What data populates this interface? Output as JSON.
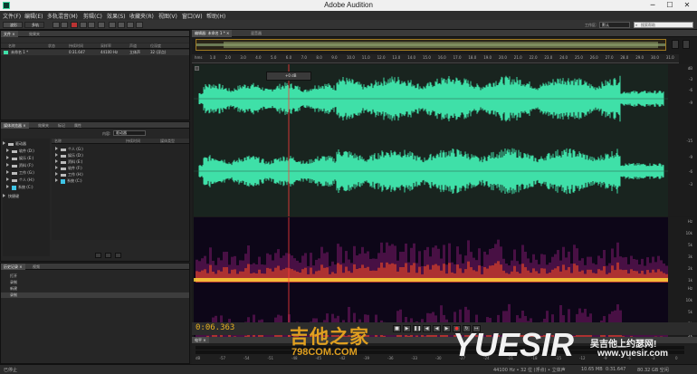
{
  "window": {
    "title": "Adobe Audition",
    "minimize": "─",
    "maximize": "☐",
    "close": "✕"
  },
  "menu": [
    "文件(F)",
    "编辑(E)",
    "多轨混音(M)",
    "剪辑(C)",
    "效果(S)",
    "收藏夹(R)",
    "视图(V)",
    "窗口(W)",
    "帮助(H)"
  ],
  "toolbar": {
    "mode_waveform": "波形",
    "mode_multitrack": "多轨",
    "workspace_label": "工作区:",
    "workspace_value": "默认",
    "search_placeholder": "搜索帮助"
  },
  "files_panel": {
    "tabs": [
      "文件 ×",
      "效果夹"
    ],
    "columns": [
      "名称",
      "状态",
      "持续时间",
      "采样率",
      "声道",
      "位深度"
    ],
    "rows": [
      {
        "name": "未命名 1 *",
        "duration": "0:31.647",
        "sample_rate": "44100 Hz",
        "channels": "立体声",
        "bit_depth": "32 (浮点)"
      }
    ]
  },
  "browser_panel": {
    "tabs": [
      "媒体浏览器 ×",
      "效果夹",
      "标记",
      "属性"
    ],
    "content_label": "内容:",
    "content_value": "驱动器",
    "tree_header": "驱动器",
    "tree": [
      "驱动器",
      "软件 (D:)",
      "娱乐 (E:)",
      "资料 (F:)",
      "工作 (G:)",
      "个人 (H:)",
      "系统 (C:)",
      "快捷键"
    ],
    "columns": [
      "名称",
      "持续时间",
      "媒体类型"
    ],
    "drives": [
      "个人 (G:)",
      "娱乐 (D:)",
      "资料 (E:)",
      "软件 (F:)",
      "工作 (H:)",
      "系统 (C:)"
    ]
  },
  "history_panel": {
    "tabs": [
      "历史记录 ×",
      "视频"
    ],
    "items": [
      "打开",
      "录制",
      "新建",
      "录制"
    ]
  },
  "editor": {
    "tabs": [
      "编辑器: 未命名 1 * ×",
      "混音器"
    ],
    "ruler": [
      "hms",
      "1.0",
      "2.0",
      "3.0",
      "4.0",
      "5.0",
      "6.0",
      "7.0",
      "8.0",
      "9.0",
      "10.0",
      "11.0",
      "12.0",
      "13.0",
      "14.0",
      "15.0",
      "16.0",
      "17.0",
      "18.0",
      "19.0",
      "20.0",
      "21.0",
      "22.0",
      "23.0",
      "24.0",
      "25.0",
      "26.0",
      "27.0",
      "28.0",
      "29.0",
      "30.0",
      "31.0"
    ],
    "hud_value": "+0 dB",
    "db_scale": [
      "dB",
      "-3",
      "-6",
      "-9",
      "-15",
      "-9",
      "-6",
      "-3"
    ],
    "hz_scale": [
      "Hz",
      "10k",
      "5k",
      "3k",
      "2k",
      "1k"
    ],
    "time_display": "0:06.363",
    "track_letters": [
      "L",
      "R"
    ],
    "colors": {
      "waveform": "#3fe0a8",
      "playhead": "#ff3b3b",
      "track_bg": "#19241f",
      "time": "#e8b020"
    }
  },
  "levels": {
    "tab": "电平 ×",
    "scale": [
      "dB",
      "-57",
      "-54",
      "-51",
      "-48",
      "-45",
      "-42",
      "-39",
      "-36",
      "-33",
      "-30",
      "-27",
      "-24",
      "-21",
      "-18",
      "-15",
      "-12",
      "-9",
      "-6",
      "-3",
      "0"
    ]
  },
  "status": {
    "left": "已停止",
    "sample": "44100 Hz • 32 位 (浮点) • 立体声",
    "size": "10.65 MB",
    "duration": "0:31.647",
    "free": "80.32 GB 空闲"
  },
  "watermarks": {
    "guitar_cn": "吉他之家",
    "guitar_url": "798COM.COM",
    "yuesir": "YUESIR",
    "yuesir_cn": "吴吉他上约瑟网!",
    "yuesir_url": "www.yuesir.com"
  }
}
